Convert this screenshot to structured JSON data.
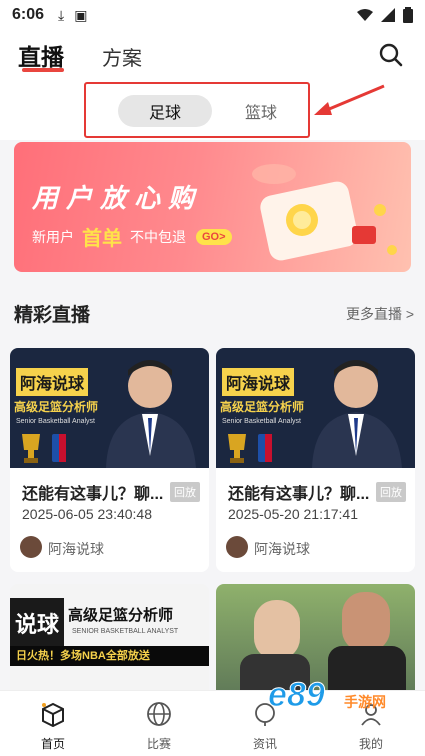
{
  "status": {
    "time": "6:06"
  },
  "header": {
    "tab_live": "直播",
    "tab_plan": "方案"
  },
  "sport_tabs": {
    "active": "足球",
    "inactive": "篮球"
  },
  "banner": {
    "title": "用户放心购",
    "prefix": "新用户",
    "highlight": "首单",
    "suffix": "不中包退",
    "go": "GO>"
  },
  "section": {
    "title": "精彩直播",
    "more": "更多直播 >"
  },
  "cards": [
    {
      "thumb_name": "阿海说球",
      "thumb_sub": "高级足篮分析师",
      "thumb_small": "Senior Basketball Analyst",
      "title": "还能有这事儿？聊...",
      "badge": "回放",
      "time": "2025-06-05 23:40:48",
      "author": "阿海说球"
    },
    {
      "thumb_name": "阿海说球",
      "thumb_sub": "高级足篮分析师",
      "thumb_small": "Senior Basketball Analyst",
      "title": "还能有这事儿？聊...",
      "badge": "回放",
      "time": "2025-05-20 21:17:41",
      "author": "阿海说球"
    }
  ],
  "card3": {
    "big": "说球",
    "sub": "高级足篮分析师",
    "small": "SENIOR BASKETBALL ANALYST",
    "strip": "日火热！多场NBA全部放送"
  },
  "nav": [
    {
      "label": "首页"
    },
    {
      "label": "比赛"
    },
    {
      "label": "资讯"
    },
    {
      "label": "我的"
    }
  ],
  "watermark": {
    "brand": "e89",
    "text": "手游网"
  },
  "colors": {
    "accent": "#e9463f",
    "annotation": "#e53935"
  }
}
